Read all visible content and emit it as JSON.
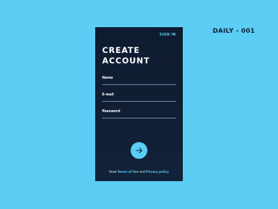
{
  "badge": {
    "label": "DAILY - 001"
  },
  "header": {
    "sign_in_label": "SIGN IN"
  },
  "form": {
    "title_line1": "CREATE",
    "title_line2": "ACCOUNT",
    "fields": [
      {
        "label": "Name",
        "value": ""
      },
      {
        "label": "E-mail",
        "value": ""
      },
      {
        "label": "Password",
        "value": ""
      }
    ],
    "submit_icon": "arrow-right-icon"
  },
  "footer": {
    "prefix": "Read",
    "terms_label": "Terms of Use",
    "connector": "and",
    "privacy_label": "Privacy policy"
  },
  "colors": {
    "background": "#5ccdf4",
    "card": "#0e1b31",
    "accent": "#5ccdf4",
    "text": "#ffffff"
  }
}
